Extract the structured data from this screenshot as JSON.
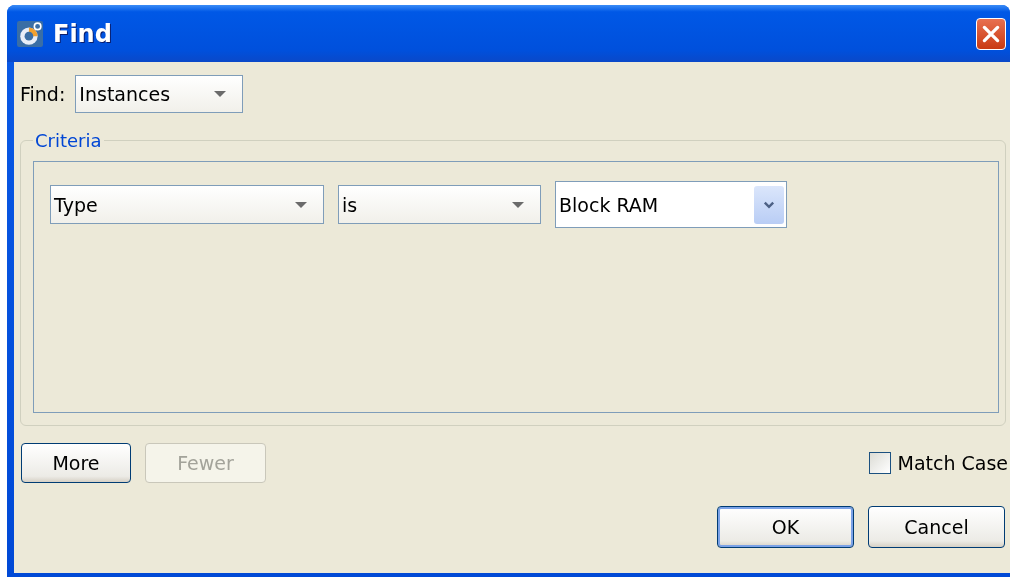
{
  "window": {
    "title": "Find"
  },
  "find": {
    "label": "Find:",
    "value": "Instances"
  },
  "criteria": {
    "legend": "Criteria",
    "rows": [
      {
        "field": "Type",
        "operator": "is",
        "value": "Block RAM"
      }
    ]
  },
  "row_buttons": [
    {
      "label": "More",
      "disabled": false
    },
    {
      "label": "Fewer",
      "disabled": true
    }
  ],
  "match_case": {
    "label": "Match Case",
    "checked": false
  },
  "dialog_buttons": [
    {
      "label": "OK",
      "default": true
    },
    {
      "label": "Cancel",
      "default": false
    }
  ]
}
